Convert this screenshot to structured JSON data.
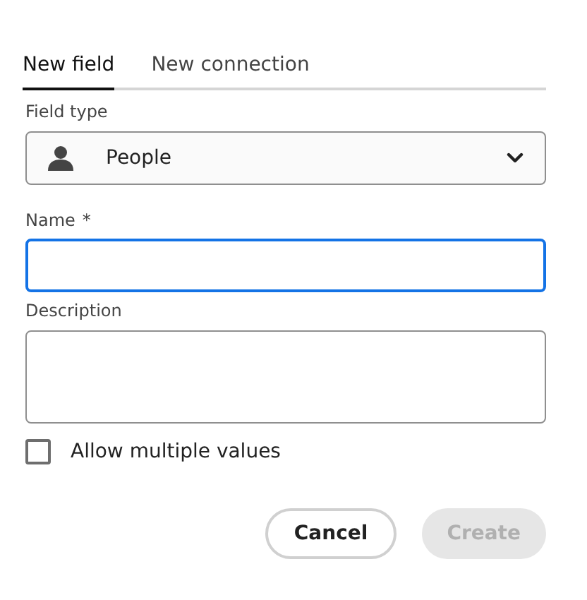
{
  "tabs": [
    {
      "label": "New field",
      "selected": true
    },
    {
      "label": "New connection",
      "selected": false
    }
  ],
  "field_type": {
    "label": "Field type",
    "value": "People"
  },
  "name": {
    "label": "Name",
    "required_mark": "*",
    "focused": true
  },
  "description": {
    "label": "Description"
  },
  "allow_multiple": {
    "label": "Allow multiple values",
    "checked": false
  },
  "buttons": [
    {
      "label": "Cancel",
      "kind": "secondary",
      "disabled": false
    },
    {
      "label": "Create",
      "kind": "primary",
      "disabled": true
    }
  ]
}
